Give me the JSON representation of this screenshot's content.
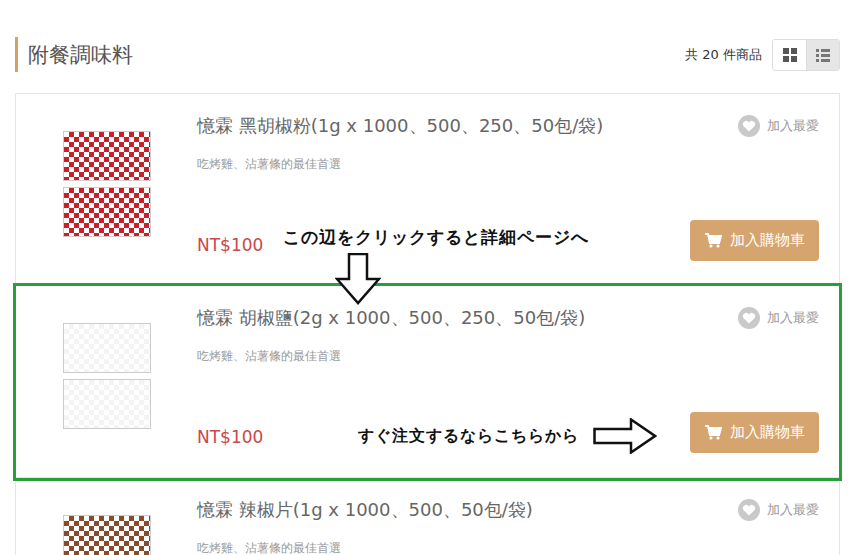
{
  "section": {
    "title": "附餐調味料",
    "count": "共 20 件商品",
    "view_options": [
      {
        "kind": "grid",
        "selected": false
      },
      {
        "kind": "list",
        "selected": true
      }
    ]
  },
  "products": [
    {
      "name": "憶霖 黑胡椒粉(1g x 1000、500、250、50包/袋)",
      "tagline": "吃烤雞、沾薯條的最佳首選",
      "price": "NT$100",
      "favorite_label": "加入最愛",
      "cart_label": "加入購物車",
      "color": "#c8202a",
      "highlighted": false
    },
    {
      "name": "憶霖 胡椒鹽(2g x 1000、500、250、50包/袋)",
      "tagline": "吃烤雞、沾薯條的最佳首選",
      "price": "NT$100",
      "favorite_label": "加入最愛",
      "cart_label": "加入購物車",
      "color": "#f4f4f4",
      "highlighted": true
    },
    {
      "name": "憶霖 辣椒片(1g x 1000、500、50包/袋)",
      "tagline": "吃烤雞、沾薯條的最佳首選",
      "favorite_label": "加入最愛",
      "color": "#8a4a2c",
      "highlighted": false
    }
  ],
  "annotations": [
    {
      "text": "この辺をクリックすると詳細ページへ",
      "arrow": "down"
    },
    {
      "text": "すぐ注文するならこちらから",
      "arrow": "right"
    }
  ]
}
